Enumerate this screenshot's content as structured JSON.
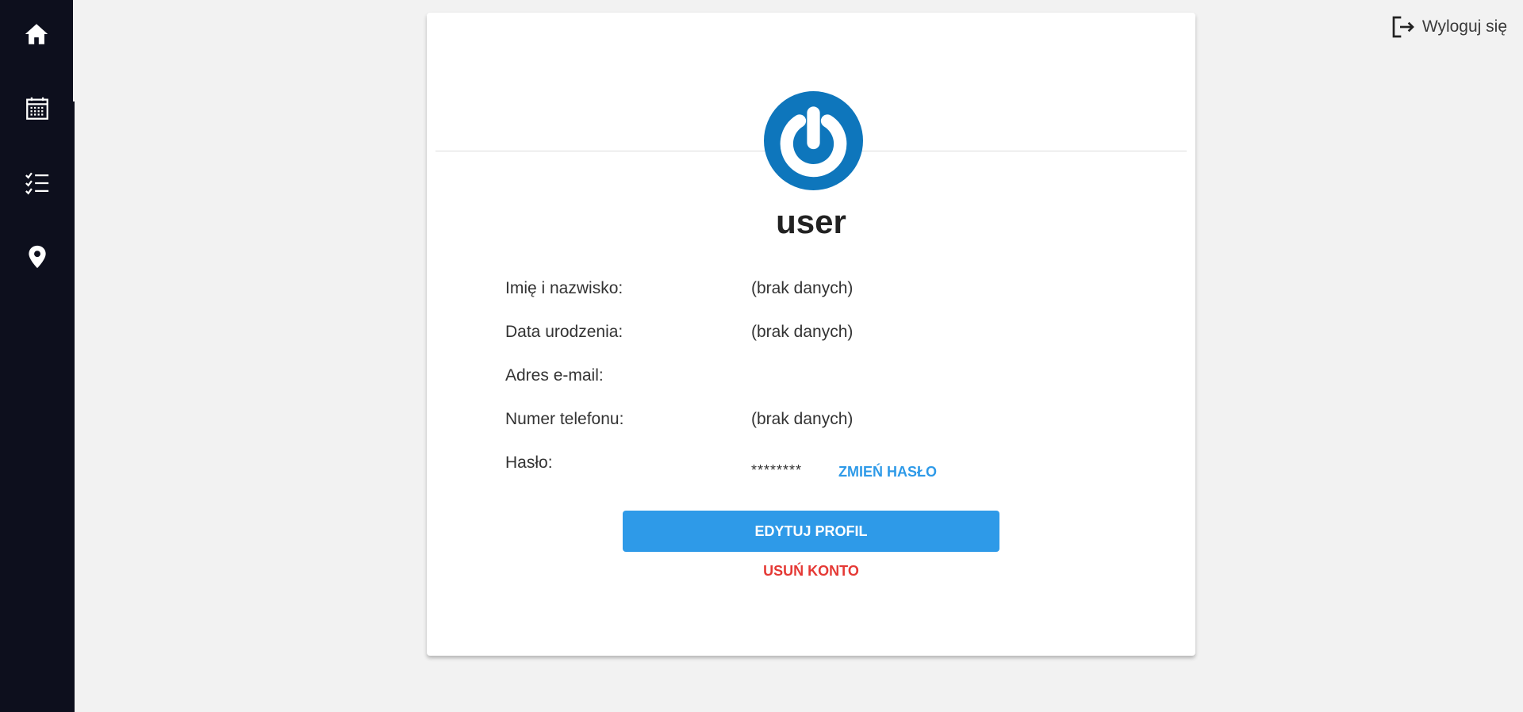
{
  "sidebar": {
    "items": [
      {
        "name": "home",
        "icon": "home-icon"
      },
      {
        "name": "calendar",
        "icon": "calendar-icon"
      },
      {
        "name": "tasks",
        "icon": "checklist-icon"
      },
      {
        "name": "location",
        "icon": "location-pin-icon"
      }
    ]
  },
  "header": {
    "logout_label": "Wyloguj się",
    "logout_icon": "logout-icon"
  },
  "profile": {
    "avatar_icon": "power-icon",
    "username": "user",
    "fields": [
      {
        "label": "Imię i nazwisko:",
        "value": "(brak danych)"
      },
      {
        "label": "Data urodzenia:",
        "value": "(brak danych)"
      },
      {
        "label": "Adres e-mail:",
        "value": ""
      },
      {
        "label": "Numer telefonu:",
        "value": "(brak danych)"
      },
      {
        "label": "Hasło:",
        "value": "********"
      }
    ],
    "change_password_label": "ZMIEŃ HASŁO",
    "edit_profile_label": "EDYTUJ PROFIL",
    "delete_account_label": "USUŃ KONTO"
  },
  "colors": {
    "sidebar_bg": "#0d0f1d",
    "accent": "#2e9ae8",
    "danger": "#e53935",
    "avatar": "#0e76bc"
  }
}
